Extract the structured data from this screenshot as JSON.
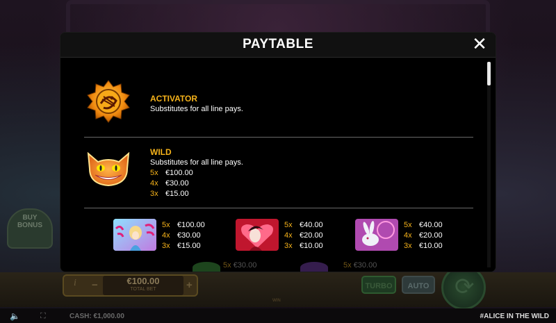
{
  "modal": {
    "title": "PAYTABLE",
    "close_label": "✕"
  },
  "symbols": {
    "activator": {
      "name": "ACTIVATOR",
      "description": "Substitutes for all line pays."
    },
    "wild": {
      "name": "WILD",
      "description": "Substitutes for all line pays.",
      "pays": [
        {
          "mult": "5x",
          "amount": "€100.00"
        },
        {
          "mult": "4x",
          "amount": "€30.00"
        },
        {
          "mult": "3x",
          "amount": "€15.00"
        }
      ]
    },
    "eat_me_drink_me": {
      "pays": [
        {
          "mult": "5x",
          "amount": "€100.00"
        },
        {
          "mult": "4x",
          "amount": "€30.00"
        },
        {
          "mult": "3x",
          "amount": "€15.00"
        }
      ]
    },
    "queen_of_hearts": {
      "pays": [
        {
          "mult": "5x",
          "amount": "€40.00"
        },
        {
          "mult": "4x",
          "amount": "€20.00"
        },
        {
          "mult": "3x",
          "amount": "€10.00"
        }
      ]
    },
    "white_rabbit": {
      "pays": [
        {
          "mult": "5x",
          "amount": "€40.00"
        },
        {
          "mult": "4x",
          "amount": "€20.00"
        },
        {
          "mult": "3x",
          "amount": "€10.00"
        }
      ]
    },
    "next_row": [
      {
        "mult": "5x",
        "amount": "€30.00"
      },
      {
        "mult": "5x",
        "amount": "€30.00"
      }
    ]
  },
  "background": {
    "buy_bonus_line1": "BUY",
    "buy_bonus_line2": "BONUS",
    "bet_value": "€100.00",
    "bet_label": "TOTAL BET",
    "bet_minus": "−",
    "bet_plus": "+",
    "info": "i",
    "turbo": "TURBO",
    "auto": "AUTO",
    "cash_label": "CASH: €1,000.00",
    "game_name": "#ALICE IN THE WILD",
    "center_mini": "WIN"
  },
  "colors": {
    "accent": "#f5b21a",
    "modal_bg": "#000000",
    "divider": "#6a6a6a"
  },
  "icons": [
    "close-icon",
    "activator-icon",
    "wild-cat-icon",
    "sound-icon",
    "fullscreen-icon",
    "spin-icon"
  ]
}
